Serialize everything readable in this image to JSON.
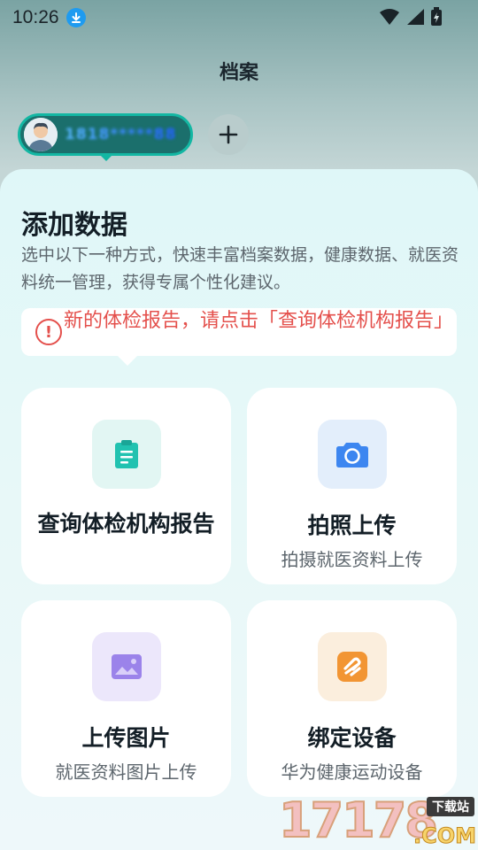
{
  "status_bar": {
    "time": "10:26",
    "icons": [
      "download-icon",
      "wifi-icon",
      "signal-icon",
      "battery-charging-icon"
    ]
  },
  "header": {
    "title": "档案"
  },
  "profile": {
    "name": "1818*****88",
    "add_icon": "plus-icon"
  },
  "sheet": {
    "title": "添加数据",
    "description": "选中以下一种方式，快速丰富档案数据，健康数据、就医资料统一管理，获得专属个性化建议。",
    "tip": {
      "icon": "warning-circle-icon",
      "text": "新的体检报告，请点击「查询体检机构报告」",
      "color": "#e4504c"
    },
    "cards": [
      {
        "title": "查询体检机构报告",
        "subtitle": "",
        "icon": "clipboard-icon",
        "icon_bg": "#e2f6f3",
        "icon_color": "#21c2b0"
      },
      {
        "title": "拍照上传",
        "subtitle": "拍摄就医资料上传",
        "icon": "camera-icon",
        "icon_bg": "#e3eefb",
        "icon_color": "#3d86f0"
      },
      {
        "title": "上传图片",
        "subtitle": "就医资料图片上传",
        "icon": "image-icon",
        "icon_bg": "#ece7fb",
        "icon_color": "#9b83ea"
      },
      {
        "title": "绑定设备",
        "subtitle": "华为健康运动设备",
        "icon": "device-band-icon",
        "icon_bg": "#fbeedd",
        "icon_color": "#f29533"
      }
    ]
  },
  "watermark": {
    "number": "17178",
    "tag": "下载站",
    "suffix": ".COM"
  }
}
